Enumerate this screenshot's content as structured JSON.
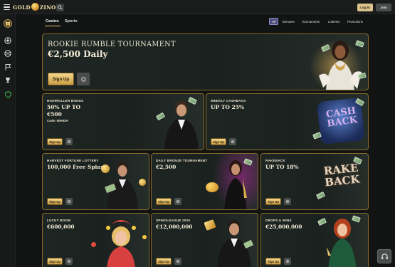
{
  "header": {
    "logo_left": "GOLD",
    "logo_right": "ZINO",
    "login_label": "Log In",
    "join_label": "Join"
  },
  "sidebar": {
    "items": [
      {
        "icon": "promotions-gift-icon"
      },
      {
        "icon": "casino-chip-icon"
      },
      {
        "icon": "sports-ball-icon"
      },
      {
        "icon": "race-flag-icon"
      },
      {
        "icon": "tournament-icon"
      },
      {
        "icon": "support-shield-icon"
      }
    ]
  },
  "tabs": [
    {
      "label": "Casino",
      "active": true
    },
    {
      "label": "Sports",
      "active": false
    }
  ],
  "filters": [
    {
      "label": "All",
      "active": true
    },
    {
      "label": "Bonuses"
    },
    {
      "label": "Tournaments"
    },
    {
      "label": "Lotteries"
    },
    {
      "label": "Promotions"
    }
  ],
  "hero": {
    "eyebrow": "Rookie Rumble Tournament",
    "headline": "€2,500 Daily",
    "button": "Sign Up"
  },
  "cards": [
    {
      "eyebrow": "HIGHROLLER BONUS",
      "headline": "50% UP TO",
      "headline2": "€500",
      "sub": "Code: 50HIGH",
      "button": "Sign Up"
    },
    {
      "eyebrow": "WEEKLY CASHBACK",
      "headline": "UP TO 25%",
      "button": "Sign Up",
      "badge": [
        "CASH",
        "BACK"
      ]
    },
    {
      "eyebrow": "HARVEST FORTUNE LOTTERY",
      "headline": "100,000 Free Spins",
      "button": "Sign Up"
    },
    {
      "eyebrow": "DAILY BRONZE TOURNAMENT",
      "headline": "€2,500",
      "button": "Sign Up"
    },
    {
      "eyebrow": "RAKEBACK",
      "headline": "UP TO 18%",
      "button": "Sign Up",
      "badge": [
        "RAKE",
        "BACK"
      ]
    },
    {
      "eyebrow": "LUCKY BOOM",
      "headline": "€600,000",
      "button": "Sign Up"
    },
    {
      "eyebrow": "SPINOLEAGUE 2026",
      "headline": "€12,000,000",
      "button": "Sign Up"
    },
    {
      "eyebrow": "DROPS & WINS",
      "headline": "€25,000,000",
      "button": "Sign Up"
    }
  ],
  "colors": {
    "accent_gold": "#e7c36a",
    "card_border": "#8a6a2b",
    "background": "#121413"
  }
}
